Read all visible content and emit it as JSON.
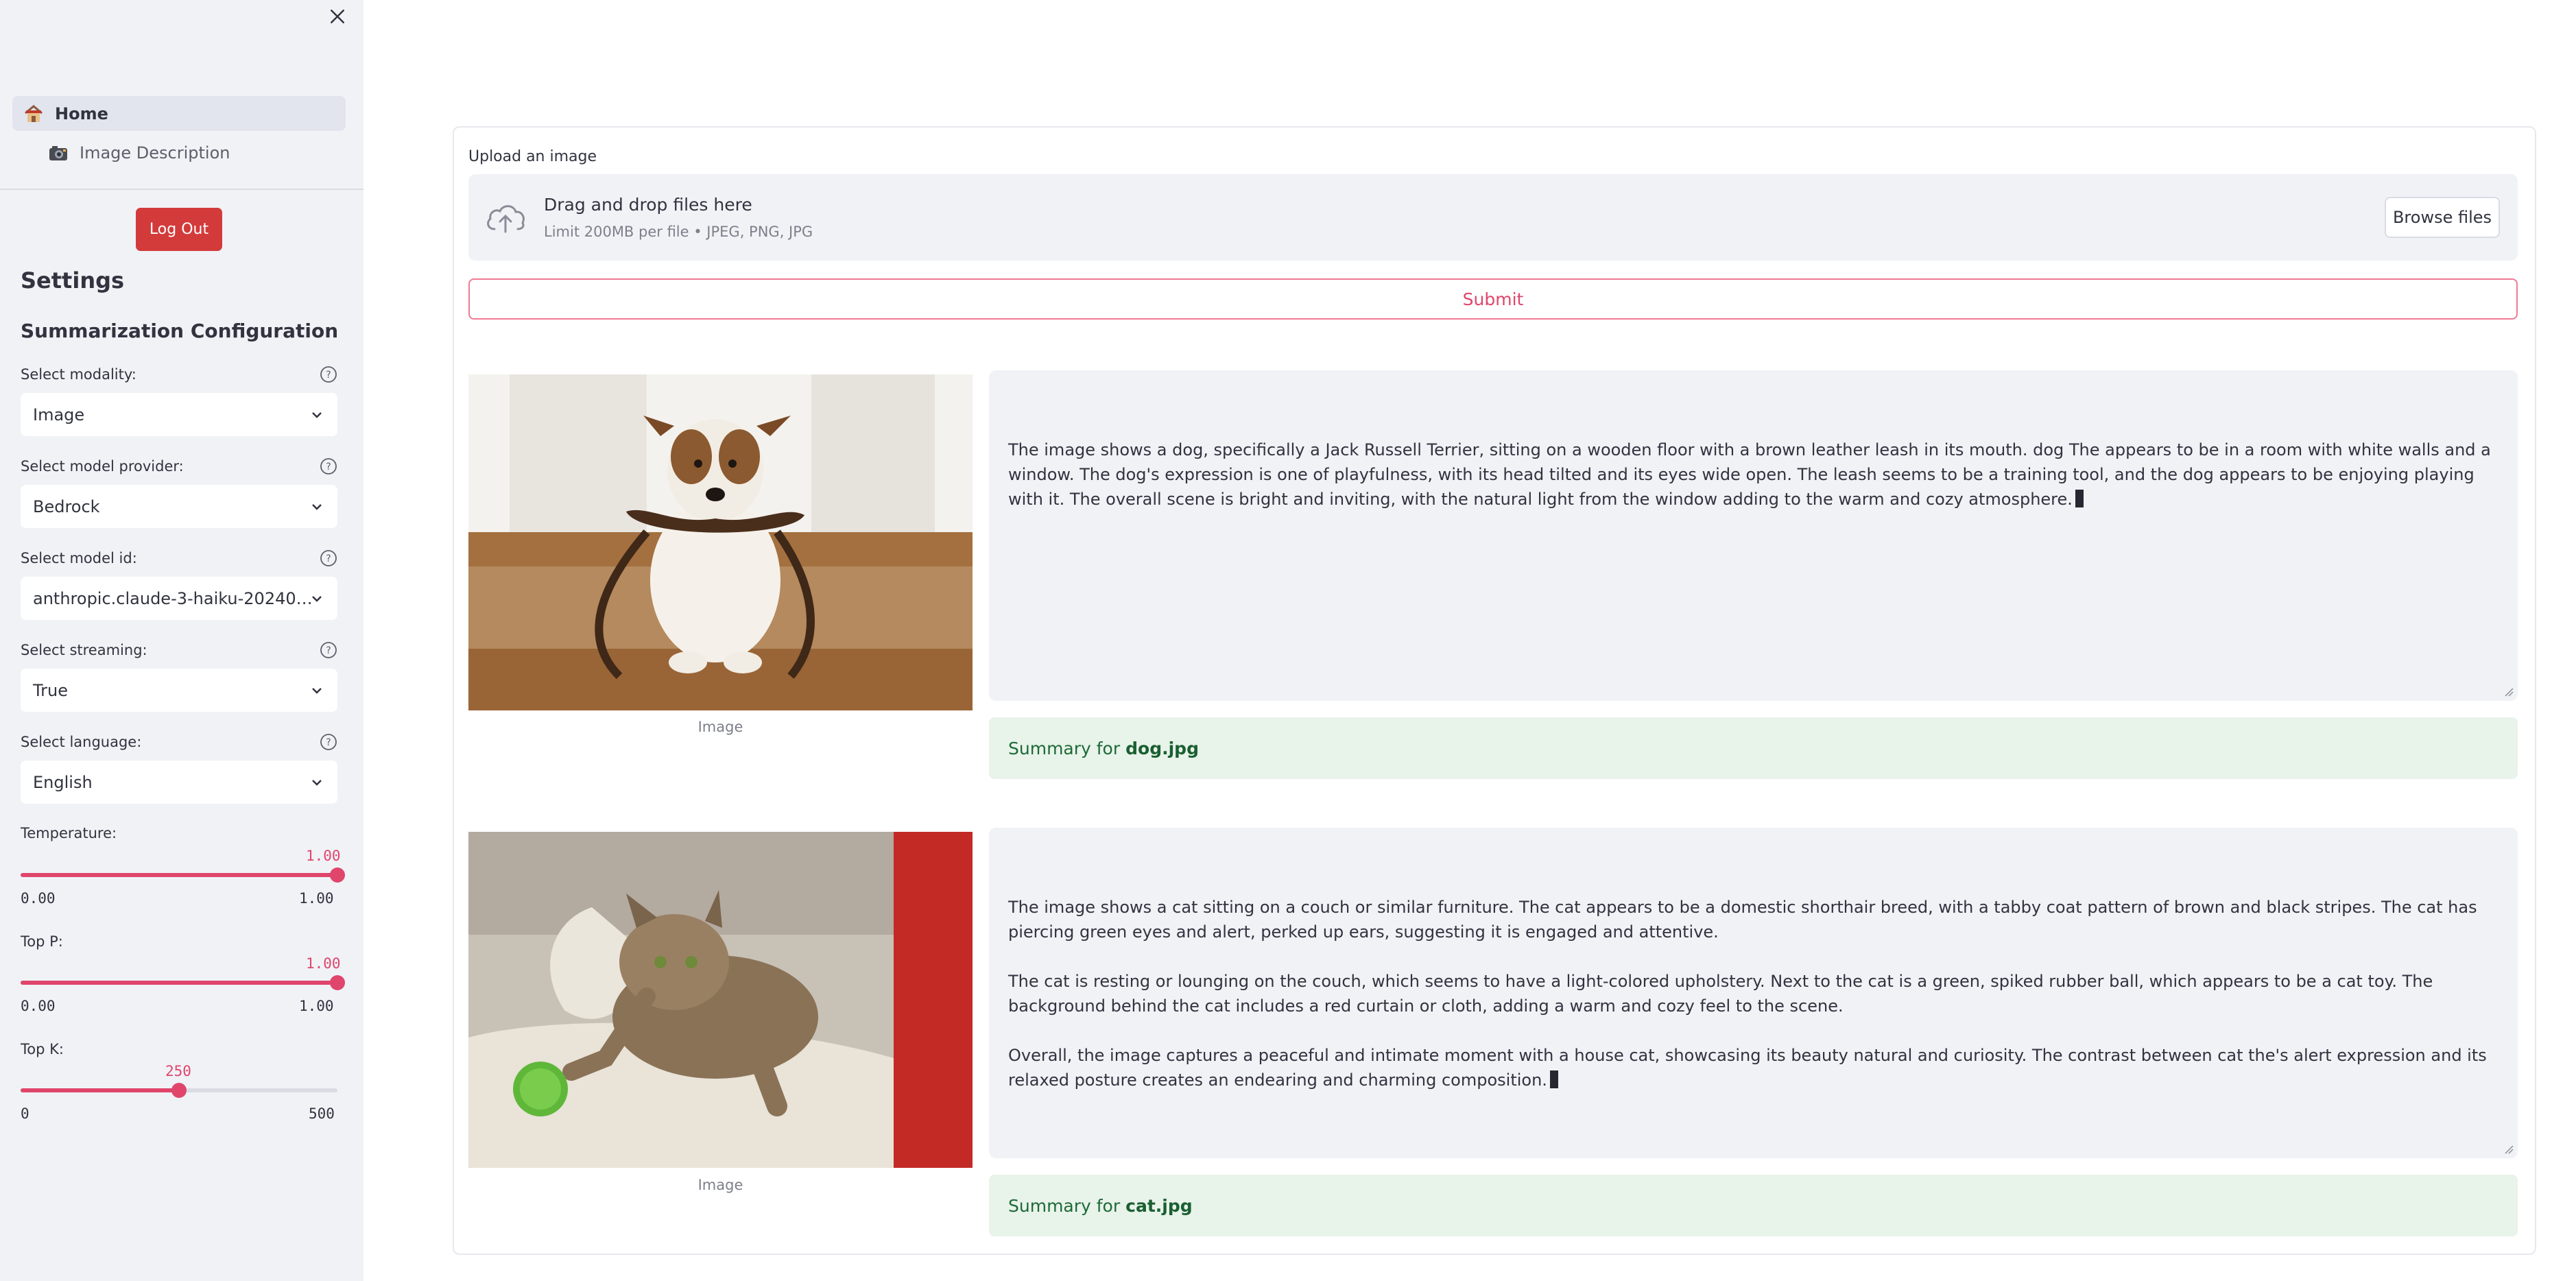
{
  "sidebar": {
    "nav": [
      {
        "label": "Home",
        "icon": "house-icon",
        "active": true
      },
      {
        "label": "Image Description",
        "icon": "camera-icon",
        "active": false
      }
    ],
    "logout_label": "Log Out",
    "settings_title": "Settings",
    "config_title": "Summarization Configuration",
    "selects": [
      {
        "label": "Select modality:",
        "value": "Image"
      },
      {
        "label": "Select model provider:",
        "value": "Bedrock"
      },
      {
        "label": "Select model id:",
        "value": "anthropic.claude-3-haiku-20240…"
      },
      {
        "label": "Select streaming:",
        "value": "True"
      },
      {
        "label": "Select language:",
        "value": "English"
      }
    ],
    "sliders": [
      {
        "label": "Temperature:",
        "value_text": "1.00",
        "min_text": "0.00",
        "max_text": "1.00",
        "fraction": 1.0
      },
      {
        "label": "Top P:",
        "value_text": "1.00",
        "min_text": "0.00",
        "max_text": "1.00",
        "fraction": 1.0
      },
      {
        "label": "Top K:",
        "value_text": "250",
        "min_text": "0",
        "max_text": "500",
        "fraction": 0.5
      }
    ]
  },
  "upload": {
    "label": "Upload an image",
    "dropzone_title": "Drag and drop files here",
    "dropzone_limit": "Limit 200MB per file • JPEG, PNG, JPG",
    "browse_label": "Browse files",
    "submit_label": "Submit"
  },
  "results": [
    {
      "caption": "Image",
      "paragraphs": [
        "The image shows a dog, specifically a Jack Russell Terrier, sitting on a wooden floor with a brown leather leash in its mouth. dog The appears to be in a room with white walls and a window. The dog's expression is one of playfulness, with its head tilted and its eyes wide open. The leash seems to be a training tool, and the dog appears to be enjoying playing with it. The overall scene is bright and inviting, with the natural light from the window adding to the warm and cozy atmosphere."
      ],
      "summary_prefix": "Summary for",
      "summary_file": "dog.jpg"
    },
    {
      "caption": "Image",
      "paragraphs": [
        "The image shows a cat sitting on a couch or similar furniture. The cat appears to be a domestic shorthair breed, with a tabby coat pattern of brown and black stripes. The cat has piercing green eyes and alert, perked up ears, suggesting it is engaged and attentive.",
        "The cat is resting or lounging on the couch, which seems to have a light-colored upholstery. Next to the cat is a green, spiked rubber ball, which appears to be a cat toy. The background behind the cat includes a red curtain or cloth, adding a warm and cozy feel to the scene.",
        "Overall, the image captures a peaceful and intimate moment with a house cat, showcasing its beauty natural and curiosity. The contrast between cat the's alert expression and its relaxed posture creates an endearing and charming composition."
      ],
      "summary_prefix": "Summary for",
      "summary_file": "cat.jpg"
    }
  ],
  "colors": {
    "sidebar_bg": "#f0f2f6",
    "primary": "#e0456b",
    "logout": "#d33b3b",
    "success_bg": "#e8f3ea",
    "success_text": "#1d6a37"
  }
}
